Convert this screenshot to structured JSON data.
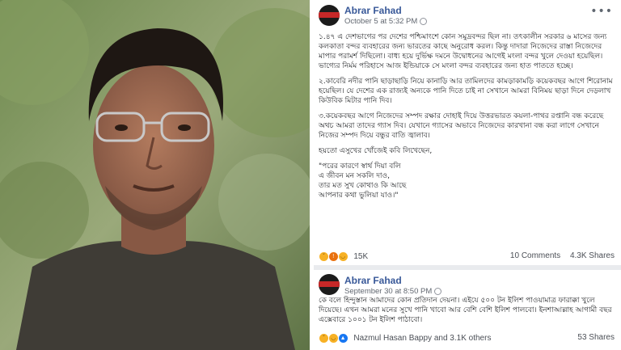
{
  "post1": {
    "author": "Abrar Fahad",
    "timestamp": "October 5 at 5:32 PM",
    "paragraphs": [
      "১.৪৭ এ দেশভাগের পর দেশের পশ্চিমাংশে কোন সমুদ্রবন্দর ছিল না। তৎকালীন সরকার ৬ মাসের জন্য কলকাতা বন্দর ব্যবহারের জন্য ভারতের কাছে অনুরোধ করল। কিন্তু দাদারা নিজেদের রাস্তা নিজেদের মাপার পরামর্শ দিছিলো। বাধ্য হয়ে দুর্ভিক্ষ দমনে উদ্বোধনের আগেই মংলা বন্দর খুলে দেওয়া হয়েছিল। ভাগ্যের নির্মম পরিহাসে আজ ইন্ডিয়াকে সে মংলা বন্দর ব্যবহারের জন্য হাত পাততে হচ্ছে।",
      "২.কাবেরি নদীর পানি ছাড়াছাড়ি নিয়ে কানাড়ি আর তামিলদের কামড়াকামড়ি কয়েকবছর আগে শিরোনাম হয়েছিল। যে দেশের এক রাজ্যই অন্যকে পানি দিতে চাই না সেখানে আমরা বিনিময় ছাড়া দিনে দেড়লাখ কিউবিক মিটার পানি দিব।",
      "৩.কয়েকবছর আগে নিজেদের সম্পদ রক্ষার দোহাই দিয়ে উত্তরভারত কয়লা-পাথর রপ্তানি বন্ধ করেছে অথচ আমরা তাদের গ্যাস দিব। যেখানে গ্যাসের অভাবে নিজেদের কারখানা বন্ধ করা লাগে সেখানে নিজের সম্পদ দিয়ে বন্ধুর বাতি জ্বালাব।",
      "হয়তো এসুখের খোঁজেই কবি লিখেছেন,"
    ],
    "poem": [
      "\"পরের কারণে স্বার্থ দিয়া বলি",
      "এ জীবন মন সকলি দাও,",
      "তার মত সুখ কোথাও কি আছে",
      "আপনার কথা ভুলিয়া যাও।\""
    ],
    "reaction_count": "15K",
    "comments": "10 Comments",
    "shares": "4.3K Shares"
  },
  "post2": {
    "author": "Abrar Fahad",
    "timestamp": "September 30 at 8:50 PM",
    "text": "কে বলে হিন্দুস্তান আমাদের কোন প্রতিদান দেয়না। এইযে ৫০০ টন ইলিশ পাওয়ামাত্র ফারাক্কা খুলে দিয়েছে। এখন আমরা মনের সুখে পানি খাবো আর বেশি বেশি ইলিশ পালবো। ইনশাআল্লাহ আগামী বছর এক্সেবারে ১০০১ টন ইলিশ পাঠাবো।",
    "reactors": "Nazmul Hasan Bappy and 3.1K others",
    "shares": "53 Shares"
  },
  "colors": {
    "author_link": "#385898",
    "feed_background": "#e9ebee"
  }
}
